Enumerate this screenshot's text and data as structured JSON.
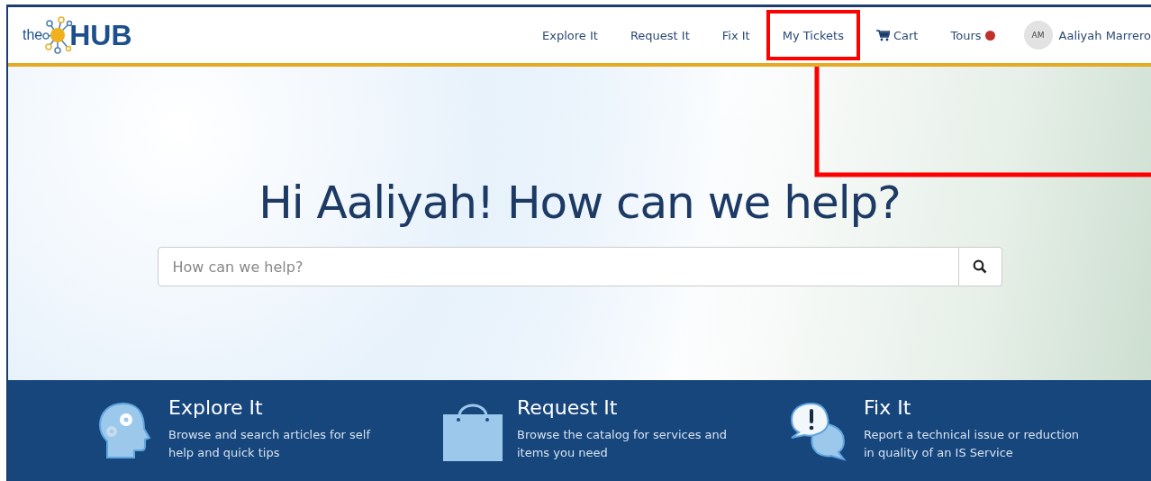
{
  "logo": {
    "prefix": "the",
    "name": "HUB"
  },
  "nav": [
    {
      "label": "Explore It",
      "kind": "link",
      "highlighted": false
    },
    {
      "label": "Request It",
      "kind": "link",
      "highlighted": false
    },
    {
      "label": "Fix It",
      "kind": "link",
      "highlighted": false
    },
    {
      "label": "My Tickets",
      "kind": "link",
      "highlighted": true
    },
    {
      "label": "Cart",
      "kind": "cart",
      "highlighted": false
    },
    {
      "label": "Tours",
      "kind": "tours",
      "highlighted": false
    }
  ],
  "user": {
    "initials": "AM",
    "name": "Aaliyah Marrero"
  },
  "hero": {
    "heading": "Hi Aaliyah! How can we help?",
    "search_placeholder": "How can we help?"
  },
  "features": [
    {
      "kind": "explore",
      "title": "Explore It",
      "text": "Browse and search articles for self help and quick tips"
    },
    {
      "kind": "request",
      "title": "Request It",
      "text": "Browse the catalog for services and items you need"
    },
    {
      "kind": "fix",
      "title": "Fix It",
      "text": "Report a technical issue or reduction in quality of an IS Service"
    }
  ]
}
